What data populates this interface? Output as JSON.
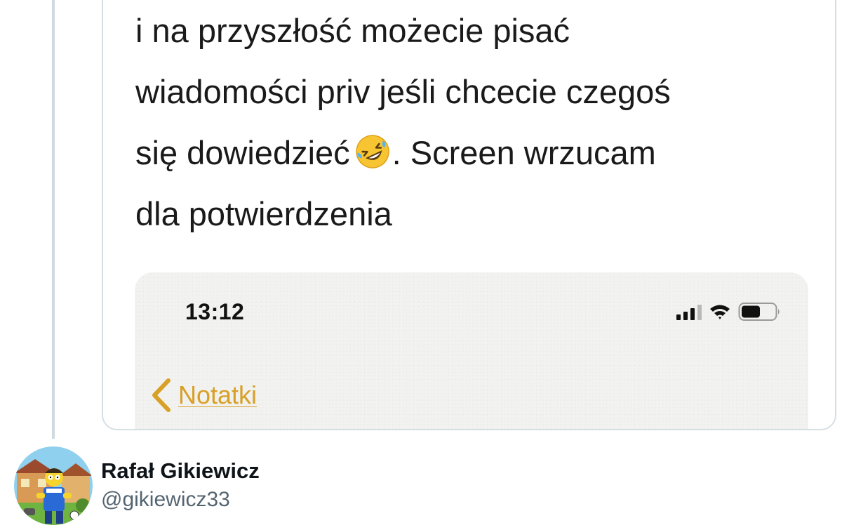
{
  "quote": {
    "lines": [
      "i  na przyszłość możecie pisać",
      "wiadomości priv jeśli chcecie czegoś",
      "się dowiedzieć",
      ". Screen wrzucam",
      "dla potwierdzenia"
    ],
    "emoji": "rolling-on-floor-laughing"
  },
  "embedded_screenshot": {
    "time": "13:12",
    "back_label": "Notatki",
    "accent_color": "#d8a026",
    "status_icons": [
      "cellular-signal-icon",
      "wifi-icon",
      "battery-icon"
    ]
  },
  "author": {
    "display_name": "Rafał Gikiewicz",
    "handle": "@gikiewicz33"
  },
  "colors": {
    "border": "#d6dfe4",
    "thread_line": "#cfd9de",
    "handle_gray": "#536471"
  }
}
